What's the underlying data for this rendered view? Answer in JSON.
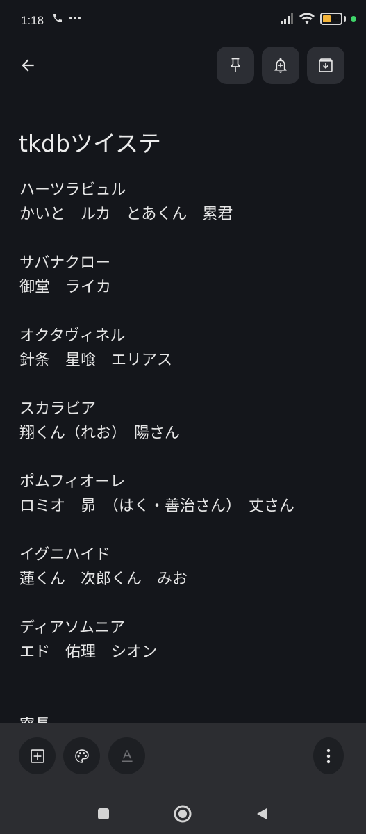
{
  "status_bar": {
    "time": "1:18",
    "battery_level": "42"
  },
  "toolbar_top": {
    "icons": [
      "arrow-left-icon",
      "pin-icon",
      "bell-plus-icon",
      "archive-icon"
    ]
  },
  "note": {
    "title": "tkdbツイステ",
    "lines": [
      "ハーツラビュル",
      "かいと　ルカ　とあくん　累君",
      "",
      "サバナクロー",
      "御堂　ライカ",
      "",
      "オクタヴィネル",
      "針条　星喰　エリアス",
      "",
      "スカラビア",
      "翔くん（れお）　陽さん",
      "",
      "ポムフィオーレ",
      "ロミオ　昴　（はく・善治さん）　丈さん",
      "",
      "イグニハイド",
      "蓮くん　次郎くん　みお",
      "",
      "ディアソムニア",
      "エド　佑理　シオン",
      "",
      "",
      "寮長"
    ]
  },
  "bottom_toolbar": {
    "icons": [
      "add-box-icon",
      "palette-icon",
      "text-format-icon",
      "more-vert-icon"
    ]
  },
  "nav_bar": {
    "icons": [
      "recents-icon",
      "home-icon",
      "back-icon"
    ]
  }
}
